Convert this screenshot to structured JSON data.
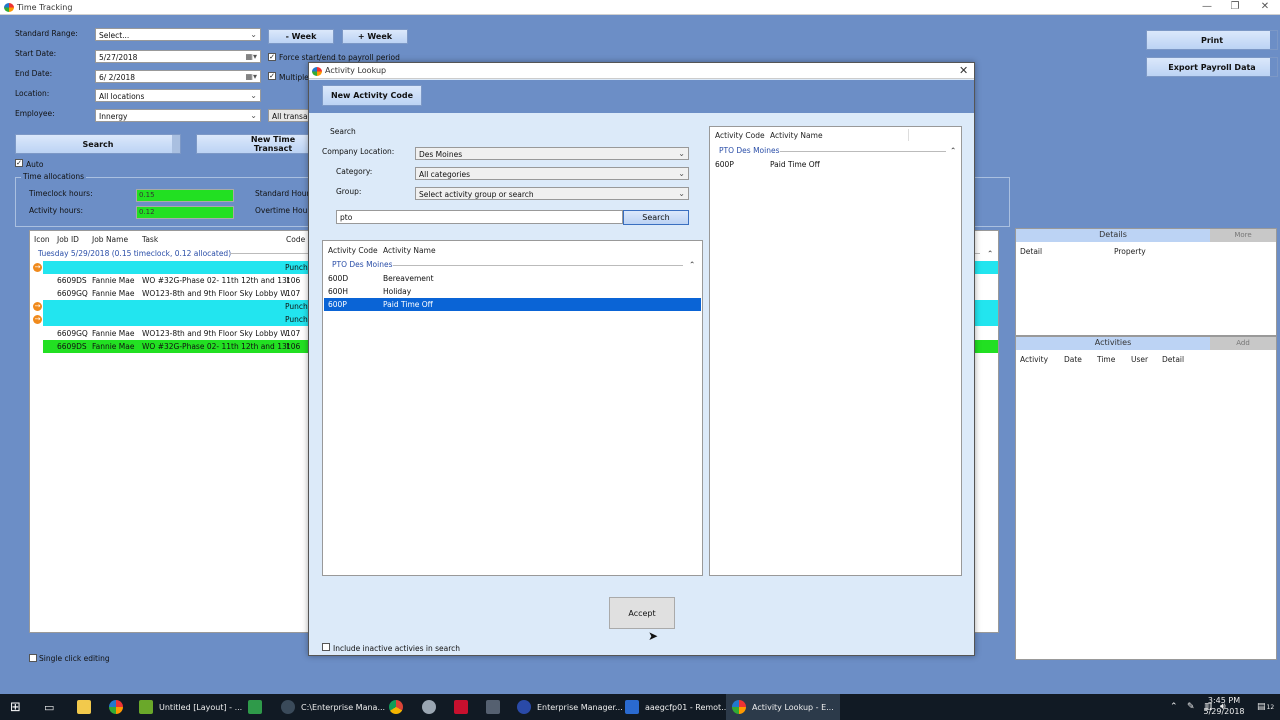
{
  "app": {
    "title": "Time Tracking"
  },
  "filters": {
    "standard_range_label": "Standard Range:",
    "standard_range_value": "Select...",
    "minus_week": "- Week",
    "plus_week": "+ Week",
    "start_date_label": "Start Date:",
    "start_date_value": "5/27/2018",
    "end_date_label": "End Date:",
    "end_date_value": "6/ 2/2018",
    "force_label": "Force start/end to payroll period",
    "multiple_label": "Multiple D",
    "location_label": "Location:",
    "location_value": "All locations",
    "employee_label": "Employee:",
    "employee_value": "Innergy",
    "transactions_value": "All transacti"
  },
  "actions": {
    "search": "Search",
    "new_time": "New Time Transact",
    "print": "Print",
    "export": "Export Payroll Data",
    "auto_label": "Auto"
  },
  "allocations": {
    "legend": "Time allocations",
    "timeclock_label": "Timeclock hours:",
    "timeclock_value": "0.15",
    "activity_label": "Activity hours:",
    "activity_value": "0.12",
    "standard_label": "Standard Hours:",
    "overtime_label": "Overtime Hours:"
  },
  "grid": {
    "headers": {
      "icon": "Icon",
      "job_id": "Job ID",
      "job_name": "Job Name",
      "task": "Task",
      "code": "Code"
    },
    "group_label": "Tuesday 5/29/2018 (0.15 timeclock, 0.12 allocated)",
    "rows": [
      {
        "type": "punch",
        "code": "Punch"
      },
      {
        "type": "job",
        "job_id": "6609DS",
        "job_name": "Fannie Mae",
        "task": "WO #32G-Phase 02- 11th 12th and 13t",
        "code": "106"
      },
      {
        "type": "job",
        "job_id": "6609GQ",
        "job_name": "Fannie Mae",
        "task": "WO123-8th and 9th Floor Sky Lobby W",
        "code": "107"
      },
      {
        "type": "punch",
        "code": "Punch"
      },
      {
        "type": "punch",
        "code": "Punch"
      },
      {
        "type": "job",
        "job_id": "6609GQ",
        "job_name": "Fannie Mae",
        "task": "WO123-8th and 9th Floor Sky Lobby W",
        "code": "107"
      },
      {
        "type": "selected",
        "job_id": "6609DS",
        "job_name": "Fannie Mae",
        "task": "WO #32G-Phase 02- 11th 12th and 13t",
        "code": "106"
      }
    ],
    "single_click": "Single click editing"
  },
  "details": {
    "title": "Details",
    "more": "More",
    "col_detail": "Detail",
    "col_property": "Property"
  },
  "activities": {
    "title": "Activities",
    "add": "Add",
    "cols": [
      "Activity",
      "Date",
      "Time",
      "User",
      "Detail"
    ]
  },
  "dialog": {
    "title": "Activity Lookup",
    "new_code": "New Activity Code",
    "search_title": "Search",
    "company_label": "Company Location:",
    "company_value": "Des Moines",
    "category_label": "Category:",
    "category_value": "All categories",
    "group_label": "Group:",
    "group_value": "Select activity group or search",
    "search_text": "pto",
    "search_btn": "Search",
    "results_headers": {
      "code": "Activity Code",
      "name": "Activity Name"
    },
    "results_group": "PTO Des Moines",
    "results": [
      {
        "code": "600D",
        "name": "Bereavement"
      },
      {
        "code": "600H",
        "name": "Holiday"
      },
      {
        "code": "600P",
        "name": "Paid Time Off"
      }
    ],
    "selected_headers": {
      "code": "Activity Code",
      "name": "Activity Name"
    },
    "selected_group": "PTO Des Moines",
    "selected": [
      {
        "code": "600P",
        "name": "Paid Time Off"
      }
    ],
    "accept": "Accept",
    "include_inactive": "Include inactive activies in search"
  },
  "taskbar": {
    "items": [
      {
        "label": "Untitled [Layout] - ...",
        "color": "#6aa82a"
      },
      {
        "label": "C:\\Enterprise Mana...",
        "color": "#3a4a5a"
      },
      {
        "label": "Enterprise Manager...",
        "color": "#2a4aa8"
      },
      {
        "label": "aaegcfp01 - Remot...",
        "color": "#2a6ad0"
      },
      {
        "label": "Activity Lookup - E...",
        "color": "#e05020"
      }
    ],
    "time": "3:45 PM",
    "date": "5/29/2018",
    "notif_count": "12"
  },
  "colors": {
    "background": "#6c8ec6",
    "punch_row": "#22e5ef",
    "selected_row": "#22e022",
    "dialog_selection": "#0a64d6"
  }
}
